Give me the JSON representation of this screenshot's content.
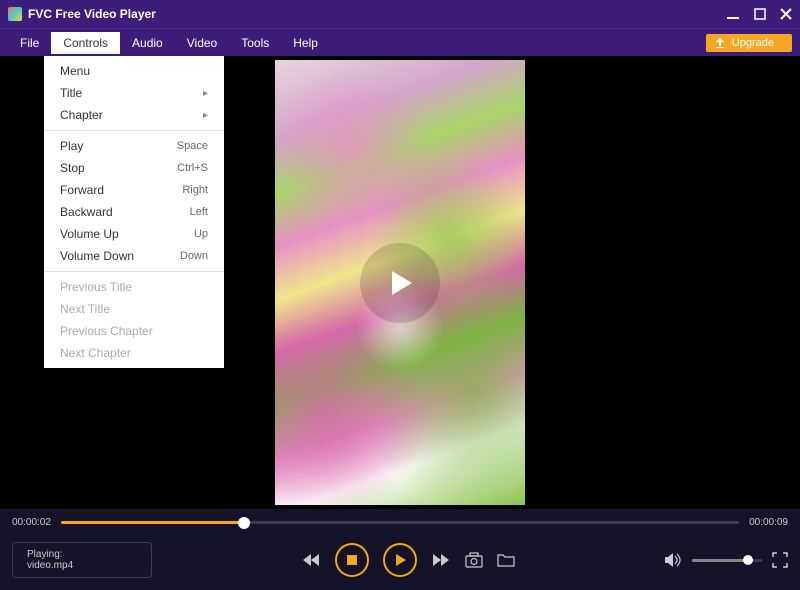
{
  "titlebar": {
    "title": "FVC Free Video Player"
  },
  "menubar": {
    "items": [
      "File",
      "Controls",
      "Audio",
      "Video",
      "Tools",
      "Help"
    ],
    "active_index": 1,
    "upgrade_label": "Upgrade"
  },
  "dropdown": {
    "groups": [
      [
        {
          "label": "Menu",
          "shortcut": "",
          "submenu": false
        },
        {
          "label": "Title",
          "shortcut": "",
          "submenu": true
        },
        {
          "label": "Chapter",
          "shortcut": "",
          "submenu": true
        }
      ],
      [
        {
          "label": "Play",
          "shortcut": "Space"
        },
        {
          "label": "Stop",
          "shortcut": "Ctrl+S"
        },
        {
          "label": "Forward",
          "shortcut": "Right"
        },
        {
          "label": "Backward",
          "shortcut": "Left"
        },
        {
          "label": "Volume Up",
          "shortcut": "Up"
        },
        {
          "label": "Volume Down",
          "shortcut": "Down"
        }
      ],
      [
        {
          "label": "Previous Title",
          "disabled": true
        },
        {
          "label": "Next Title",
          "disabled": true
        },
        {
          "label": "Previous Chapter",
          "disabled": true
        },
        {
          "label": "Next Chapter",
          "disabled": true
        }
      ]
    ]
  },
  "playback": {
    "current_time": "00:00:02",
    "total_time": "00:00:09",
    "progress_percent": 27
  },
  "status": {
    "label": "Playing:",
    "filename": "video.mp4"
  },
  "volume": {
    "percent": 80
  },
  "colors": {
    "accent": "#f5a623",
    "chrome": "#3d1d7a",
    "bg_dark": "#141327"
  }
}
